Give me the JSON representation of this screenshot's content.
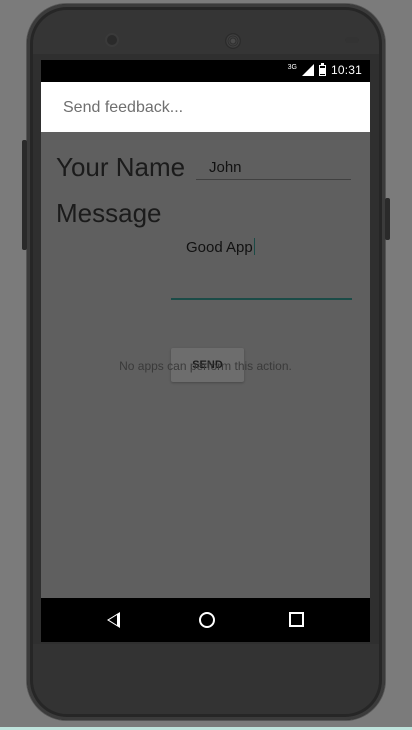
{
  "status_bar": {
    "network": "3G",
    "time": "10:31"
  },
  "toolbar": {
    "title": "Send feedback..."
  },
  "form": {
    "name_label": "Your Name",
    "name_value": "John",
    "message_label": "Message",
    "message_value": "Good App"
  },
  "actions": {
    "send_label": "SEND"
  },
  "toast": {
    "text": "No apps can perform this action."
  },
  "navigation": {
    "back_icon": "back-icon",
    "home_icon": "home-icon",
    "recents_icon": "recents-icon"
  },
  "colors": {
    "accent": "#1b4b47",
    "dim_background": "#5f5f5f"
  }
}
